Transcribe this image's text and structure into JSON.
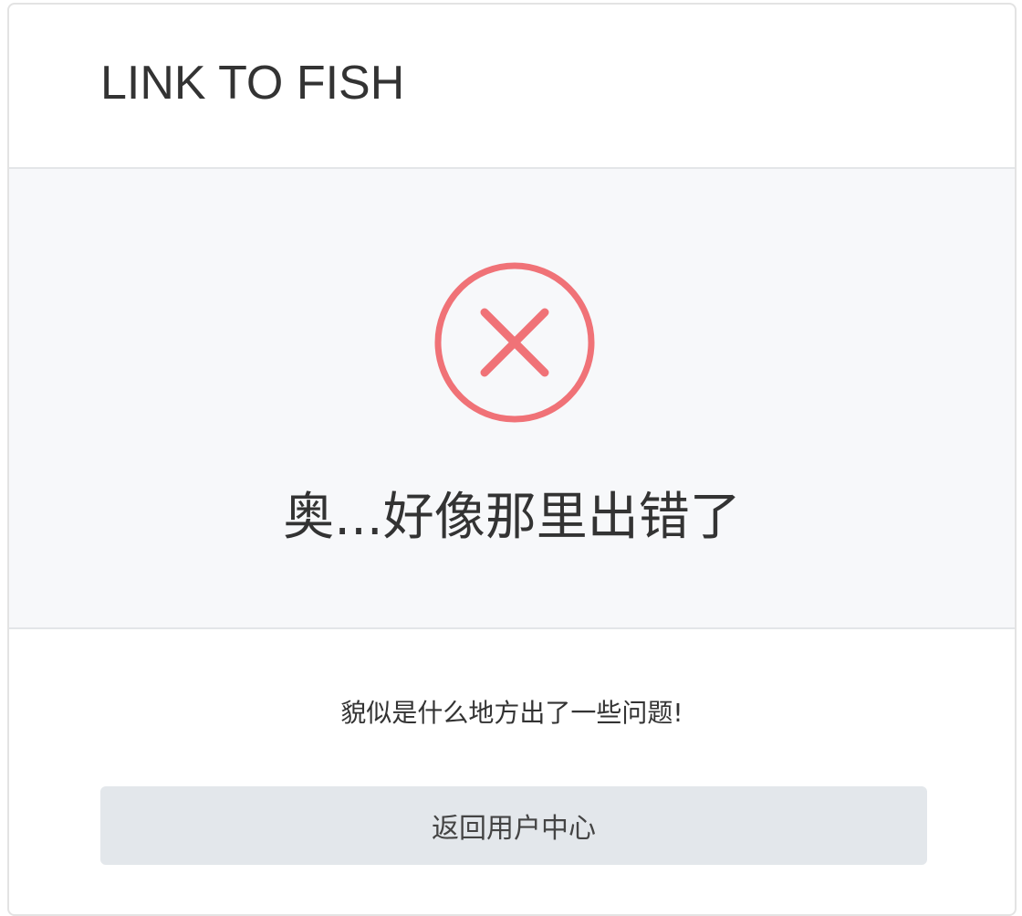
{
  "header": {
    "title": "LINK TO FISH"
  },
  "error": {
    "icon": "close-circle-icon",
    "icon_color": "#f07277",
    "heading": "奥...好像那里出错了",
    "message": "貌似是什么地方出了一些问题!"
  },
  "actions": {
    "back_label": "返回用户中心"
  },
  "colors": {
    "panel_background": "#f7f8fa",
    "button_background": "#e3e7eb",
    "text": "#333333"
  }
}
